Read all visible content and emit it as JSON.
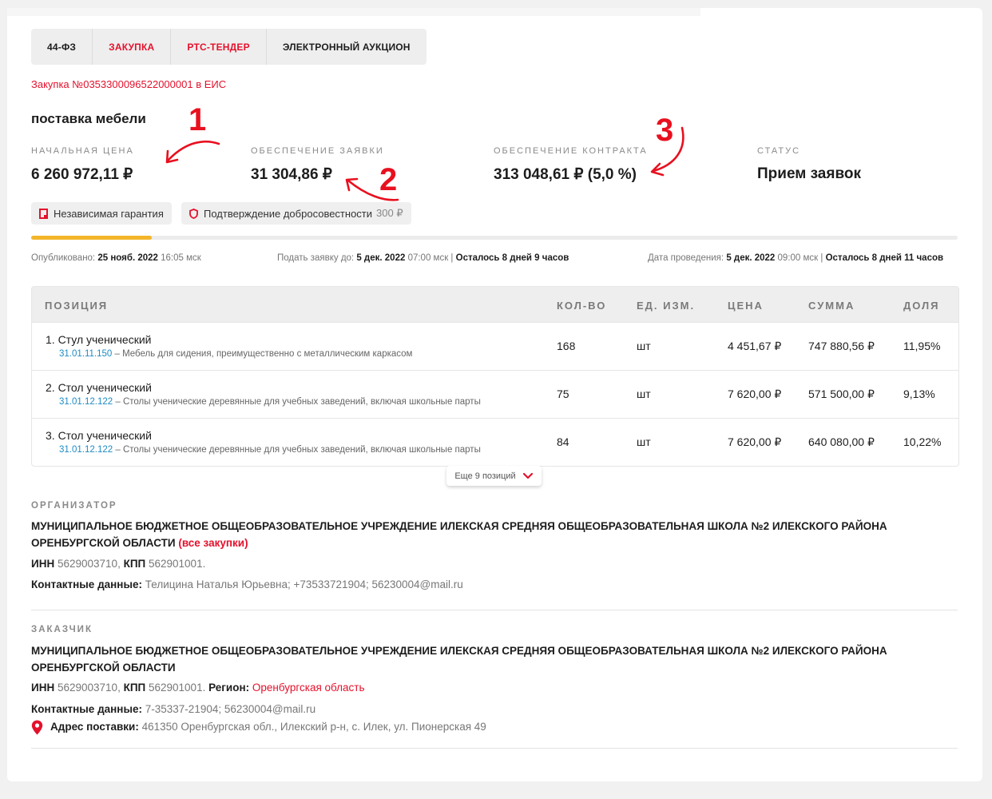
{
  "tabs": [
    {
      "label": "44-ФЗ",
      "style": "dark"
    },
    {
      "label": "ЗАКУПКА",
      "style": "red"
    },
    {
      "label": "РТС-ТЕНДЕР",
      "style": "red"
    },
    {
      "label": "ЭЛЕКТРОННЫЙ АУКЦИОН",
      "style": "dark"
    }
  ],
  "eis_link": "Закупка №0353300096522000001 в ЕИС",
  "title": "поставка мебели",
  "summary": {
    "initial_price_label": "НАЧАЛЬНАЯ ЦЕНА",
    "initial_price": "6 260 972,11 ₽",
    "bid_security_label": "ОБЕСПЕЧЕНИЕ ЗАЯВКИ",
    "bid_security": "31 304,86 ₽",
    "contract_security_label": "ОБЕСПЕЧЕНИЕ КОНТРАКТА",
    "contract_security": "313 048,61 ₽ (5,0 %)",
    "status_label": "СТАТУС",
    "status": "Прием заявок"
  },
  "annotations": [
    "1",
    "2",
    "3"
  ],
  "badges": {
    "guarantee": "Независимая гарантия",
    "confirmation": "Подтверждение добросовестности",
    "confirmation_price": "300 ₽"
  },
  "progress": {
    "fraction": 0.13
  },
  "meta": {
    "published_label": "Опубликовано:",
    "published_date": "25 нояб. 2022",
    "published_time": "16:05 мск",
    "deadline_label": "Подать заявку до:",
    "deadline_date": "5 дек. 2022",
    "deadline_time": "07:00 мск",
    "deadline_left": "Осталось 8 дней 9 часов",
    "event_label": "Дата проведения:",
    "event_date": "5 дек. 2022",
    "event_time": "09:00 мск",
    "event_left": "Осталось 8 дней 11 часов"
  },
  "table": {
    "headers": {
      "position": "ПОЗИЦИЯ",
      "qty": "КОЛ-ВО",
      "unit": "ЕД. ИЗМ.",
      "price": "ЦЕНА",
      "sum": "СУММА",
      "share": "ДОЛЯ"
    },
    "rows": [
      {
        "name": "1. Стул ученический",
        "code": "31.01.11.150",
        "desc": " – Мебель для сидения, преимущественно с металлическим каркасом",
        "qty": "168",
        "unit": "шт",
        "price": "4 451,67 ₽",
        "sum": "747 880,56 ₽",
        "share": "11,95%"
      },
      {
        "name": "2. Стол ученический",
        "code": "31.01.12.122",
        "desc": " – Столы ученические деревянные для учебных заведений, включая школьные парты",
        "qty": "75",
        "unit": "шт",
        "price": "7 620,00 ₽",
        "sum": "571 500,00 ₽",
        "share": "9,13%"
      },
      {
        "name": "3. Стол ученический",
        "code": "31.01.12.122",
        "desc": " – Столы ученические деревянные для учебных заведений, включая школьные парты",
        "qty": "84",
        "unit": "шт",
        "price": "7 620,00 ₽",
        "sum": "640 080,00 ₽",
        "share": "10,22%"
      }
    ],
    "more_label": "Еще 9 позиций"
  },
  "organizer": {
    "label": "ОРГАНИЗАТОР",
    "name": "МУНИЦИПАЛЬНОЕ БЮДЖЕТНОЕ ОБЩЕОБРАЗОВАТЕЛЬНОЕ УЧРЕЖДЕНИЕ ИЛЕКСКАЯ СРЕДНЯЯ ОБЩЕОБРАЗОВАТЕЛЬНАЯ ШКОЛА №2 ИЛЕКСКОГО РАЙОНА ОРЕНБУРГСКОЙ ОБЛАСТИ",
    "all_link": "(все закупки)",
    "inn_label": "ИНН",
    "inn": "5629003710",
    "kpp_label": "КПП",
    "kpp": "562901001.",
    "contacts_label": "Контактные данные:",
    "contacts": "Телицина Наталья Юрьевна; +73533721904; 56230004@mail.ru"
  },
  "customer": {
    "label": "ЗАКАЗЧИК",
    "name": "МУНИЦИПАЛЬНОЕ БЮДЖЕТНОЕ ОБЩЕОБРАЗОВАТЕЛЬНОЕ УЧРЕЖДЕНИЕ ИЛЕКСКАЯ СРЕДНЯЯ ОБЩЕОБРАЗОВАТЕЛЬНАЯ ШКОЛА №2 ИЛЕКСКОГО РАЙОНА ОРЕНБУРГСКОЙ ОБЛАСТИ",
    "inn_label": "ИНН",
    "inn": "5629003710",
    "kpp_label": "КПП",
    "kpp": "562901001.",
    "region_label": "Регион:",
    "region": "Оренбургская область",
    "contacts_label": "Контактные данные:",
    "contacts": "7-35337-21904; 56230004@mail.ru",
    "address_label": "Адрес поставки:",
    "address": "461350 Оренбургская обл., Илекский р-н, с. Илек, ул. Пионерская 49"
  },
  "colors": {
    "accent": "#e4112c",
    "progress": "#f3b62b",
    "link_code": "#1e8bc3",
    "annotation": "#e8101f"
  },
  "icons": {
    "guarantee": "document-icon",
    "confirmation": "shield-icon",
    "more": "chevron-down-icon",
    "address": "map-pin-icon"
  }
}
